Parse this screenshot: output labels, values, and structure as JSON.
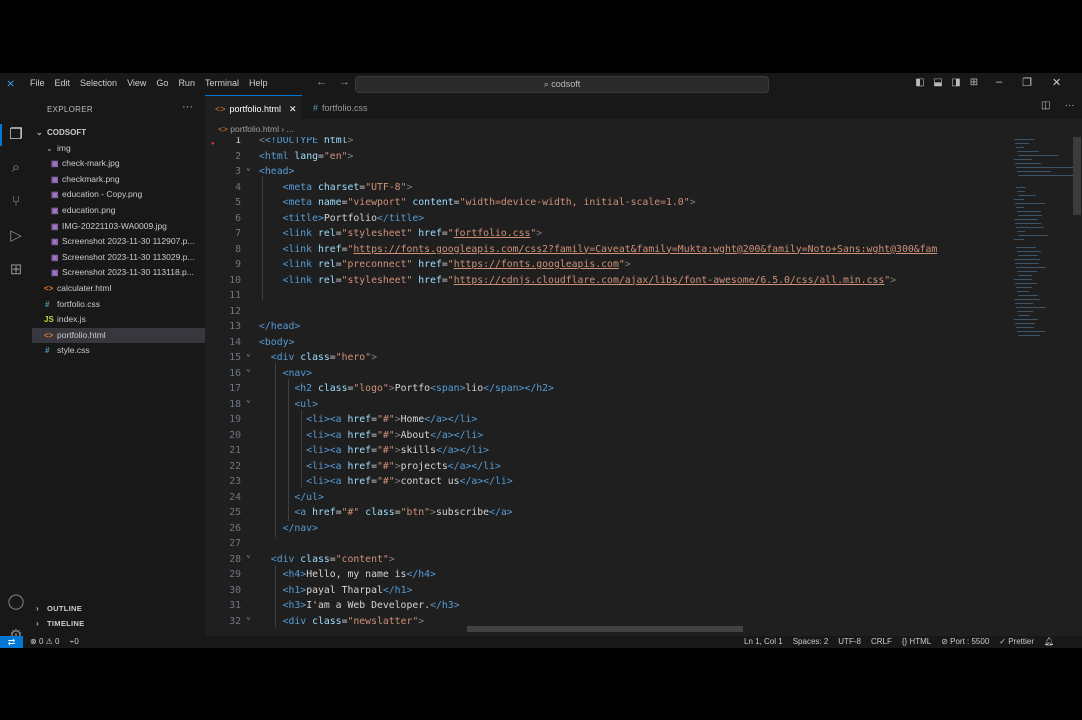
{
  "titlebar": {
    "menus": [
      "File",
      "Edit",
      "Selection",
      "View",
      "Go",
      "Run",
      "Terminal",
      "Help"
    ],
    "search": "codsoft"
  },
  "explorer": {
    "title": "EXPLORER",
    "root": "CODSOFT",
    "folder": "img",
    "img_files": [
      "check-mark.jpg",
      "checkmark.png",
      "education - Copy.png",
      "education.png",
      "IMG-20221103-WA0009.jpg",
      "Screenshot 2023-11-30 112907.p...",
      "Screenshot 2023-11-30 113029.p...",
      "Screenshot 2023-11-30 113118.p..."
    ],
    "files": [
      {
        "name": "calculater.html",
        "type": "html"
      },
      {
        "name": "fortfolio.css",
        "type": "css"
      },
      {
        "name": "index.js",
        "type": "js"
      },
      {
        "name": "portfolio.html",
        "type": "html"
      },
      {
        "name": "style.css",
        "type": "css"
      }
    ],
    "outline": "OUTLINE",
    "timeline": "TIMELINE"
  },
  "tabs": [
    {
      "label": "portfolio.html",
      "active": true
    },
    {
      "label": "fortfolio.css",
      "active": false
    }
  ],
  "breadcrumb": {
    "file": "portfolio.html",
    "rest": "..."
  },
  "code": {
    "line_numbers": [
      "1",
      "2",
      "3",
      "4",
      "5",
      "6",
      "7",
      "8",
      "9",
      "10",
      "11",
      "12",
      "13",
      "14",
      "15",
      "16",
      "17",
      "18",
      "19",
      "20",
      "21",
      "22",
      "23",
      "24",
      "25",
      "26",
      "27",
      "28",
      "29",
      "30",
      "31",
      "32"
    ],
    "l1": {
      "doctype": "<!DOCTYPE",
      "html": " html",
      "close": ">"
    },
    "l2": {
      "tag": "<html",
      "attr": " lang",
      "eq": "=",
      "val": "\"en\"",
      "close": ">"
    },
    "l3": "<head>",
    "l4": {
      "tag": "<meta",
      "attr": " charset",
      "eq": "=",
      "val": "\"UTF-8\"",
      "close": ">"
    },
    "l5": {
      "tag": "<meta",
      "attr1": " name",
      "val1": "\"viewport\"",
      "attr2": " content",
      "val2": "\"width=device-width, initial-scale=1.0\"",
      "close": ">"
    },
    "l6": {
      "open": "<title>",
      "text": "Portfolio",
      "close": "</title>"
    },
    "l7": {
      "tag": "<link",
      "attr1": " rel",
      "val1": "\"stylesheet\"",
      "attr2": " href",
      "q1": "\"",
      "link": "fortfolio.css",
      "q2": "\"",
      "close": ">"
    },
    "l8": {
      "tag": "<link",
      "attr": " href",
      "q1": "\"",
      "link": "https://fonts.googleapis.com/css2?family=Caveat&family=Mukta:wght@200&family=Noto+Sans:wght@300&fam"
    },
    "l9": {
      "tag": "<link",
      "attr1": " rel",
      "val1": "\"preconnect\"",
      "attr2": " href",
      "q1": "\"",
      "link": "https://fonts.googleapis.com",
      "q2": "\"",
      "close": ">"
    },
    "l10": {
      "tag": "<link",
      "attr1": " rel",
      "val1": "\"stylesheet\"",
      "attr2": " href",
      "q1": "\"",
      "link": "https://cdnjs.cloudflare.com/ajax/libs/font-awesome/6.5.0/css/all.min.css",
      "q2": "\"",
      "close": ">"
    },
    "l13": "</head>",
    "l14": "<body>",
    "l15": {
      "tag": "<div",
      "attr": " class",
      "val": "\"hero\"",
      "close": ">"
    },
    "l16": "<nav>",
    "l17": {
      "tag": "<h2",
      "attr": " class",
      "val": "\"logo\"",
      "gt": ">",
      "text1": "Portfo",
      "span_open": "<span>",
      "text2": "lio",
      "span_close": "</span>",
      "h2_close": "</h2>"
    },
    "l18": "<ul>",
    "nav_items": [
      "Home",
      "About",
      "skills",
      "projects",
      "contact us"
    ],
    "li_open": "<li>",
    "a_tag": "<a",
    "href_attr": " href",
    "hash": "\"#\"",
    "gt": ">",
    "a_close": "</a>",
    "li_close": "</li>",
    "l24": "</ul>",
    "l25": {
      "tag": "<a",
      "attr1": " href",
      "val1": "\"#\"",
      "attr2": " class",
      "val2": "\"btn\"",
      "gt": ">",
      "text": "subscribe",
      "close": "</a>"
    },
    "l26": "</nav>",
    "l28": {
      "tag": "<div",
      "attr": " class",
      "val": "\"content\"",
      "close": ">"
    },
    "l29": {
      "open": "<h4>",
      "text": "Hello, my name is",
      "close": "</h4>"
    },
    "l30": {
      "open": "<h1>",
      "text": "payal Tharpal",
      "close": "</h1>"
    },
    "l31": {
      "open": "<h3>",
      "text": "I'am a Web Developer.",
      "close": "</h3>"
    },
    "l32": {
      "tag": "<div",
      "attr": " class",
      "val": "\"newslatter\"",
      "close": ">"
    },
    "eq": "="
  },
  "status": {
    "errors": "0",
    "warnings": "0",
    "ports": "0",
    "position": "Ln 1, Col 1",
    "spaces": "Spaces: 2",
    "encoding": "UTF-8",
    "eol": "CRLF",
    "language": "HTML",
    "port": "Port : 5500",
    "prettier": "Prettier"
  },
  "colors": {
    "accent": "#0078d4",
    "tag": "#569cd6",
    "attr": "#9cdcfe",
    "string": "#ce9178"
  }
}
